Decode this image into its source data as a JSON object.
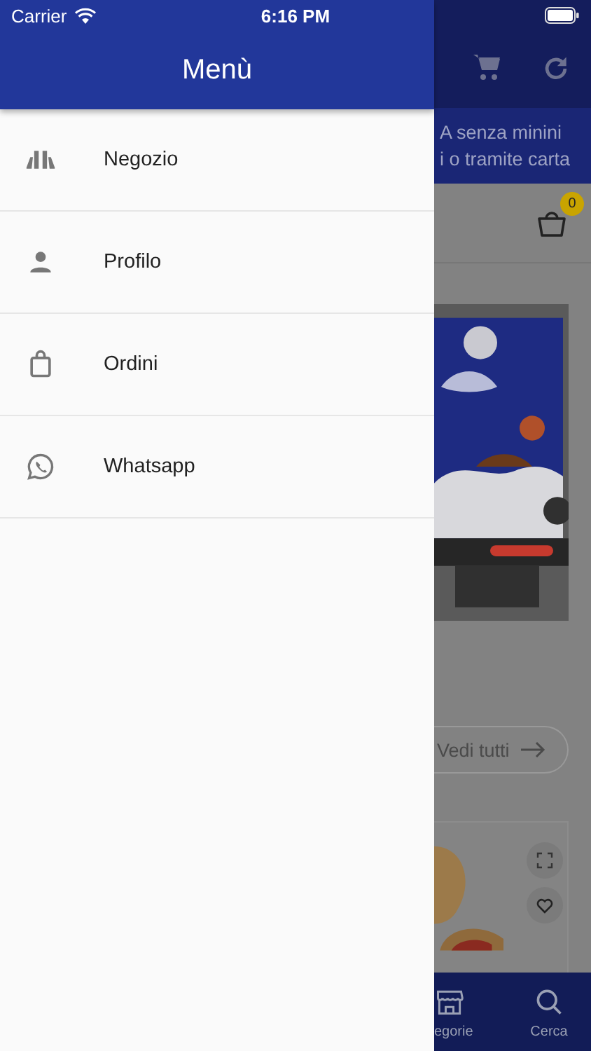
{
  "status_bar": {
    "carrier": "Carrier",
    "time": "6:16 PM"
  },
  "drawer": {
    "title": "Menù",
    "items": [
      {
        "kind": "store",
        "label": "Negozio"
      },
      {
        "kind": "person",
        "label": "Profilo"
      },
      {
        "kind": "bag",
        "label": "Ordini"
      },
      {
        "kind": "whatsapp",
        "label": "Whatsapp"
      }
    ]
  },
  "background": {
    "banner_lines": [
      "A senza minini",
      "i o tramite carta"
    ],
    "basket_badge": "0",
    "see_all_button": "Vedi tutti",
    "bottom_nav": [
      {
        "kind": "store",
        "label": "egorie"
      },
      {
        "kind": "search",
        "label": "Cerca"
      }
    ]
  }
}
